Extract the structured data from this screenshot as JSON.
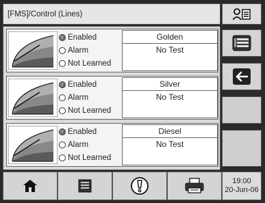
{
  "header": {
    "title": "[FMS]/Control (Lines)",
    "user_icon": "user-list-icon"
  },
  "lines": [
    {
      "name": "Golden",
      "status": "No Test",
      "indicators": [
        {
          "label": "Enabled",
          "active": true
        },
        {
          "label": "Alarm",
          "active": false
        },
        {
          "label": "Not Learned",
          "active": false
        }
      ]
    },
    {
      "name": "Silver",
      "status": "No Test",
      "indicators": [
        {
          "label": "Enabled",
          "active": true
        },
        {
          "label": "Alarm",
          "active": false
        },
        {
          "label": "Not Learned",
          "active": false
        }
      ]
    },
    {
      "name": "Diesel",
      "status": "No Test",
      "indicators": [
        {
          "label": "Enabled",
          "active": true
        },
        {
          "label": "Alarm",
          "active": false
        },
        {
          "label": "Not Learned",
          "active": false
        }
      ]
    }
  ],
  "sidebar": {
    "buttons": [
      "list-view-icon",
      "back-arrow-icon",
      "",
      ""
    ]
  },
  "footer": {
    "buttons": [
      "home-icon",
      "menu-icon",
      "alert-icon",
      "printer-icon"
    ],
    "time": "19:00",
    "date": "20-Jun-06"
  },
  "colors": {
    "background": "#2a2a2a",
    "panel": "#d9d9d9",
    "gauge_fill": "#888888"
  }
}
